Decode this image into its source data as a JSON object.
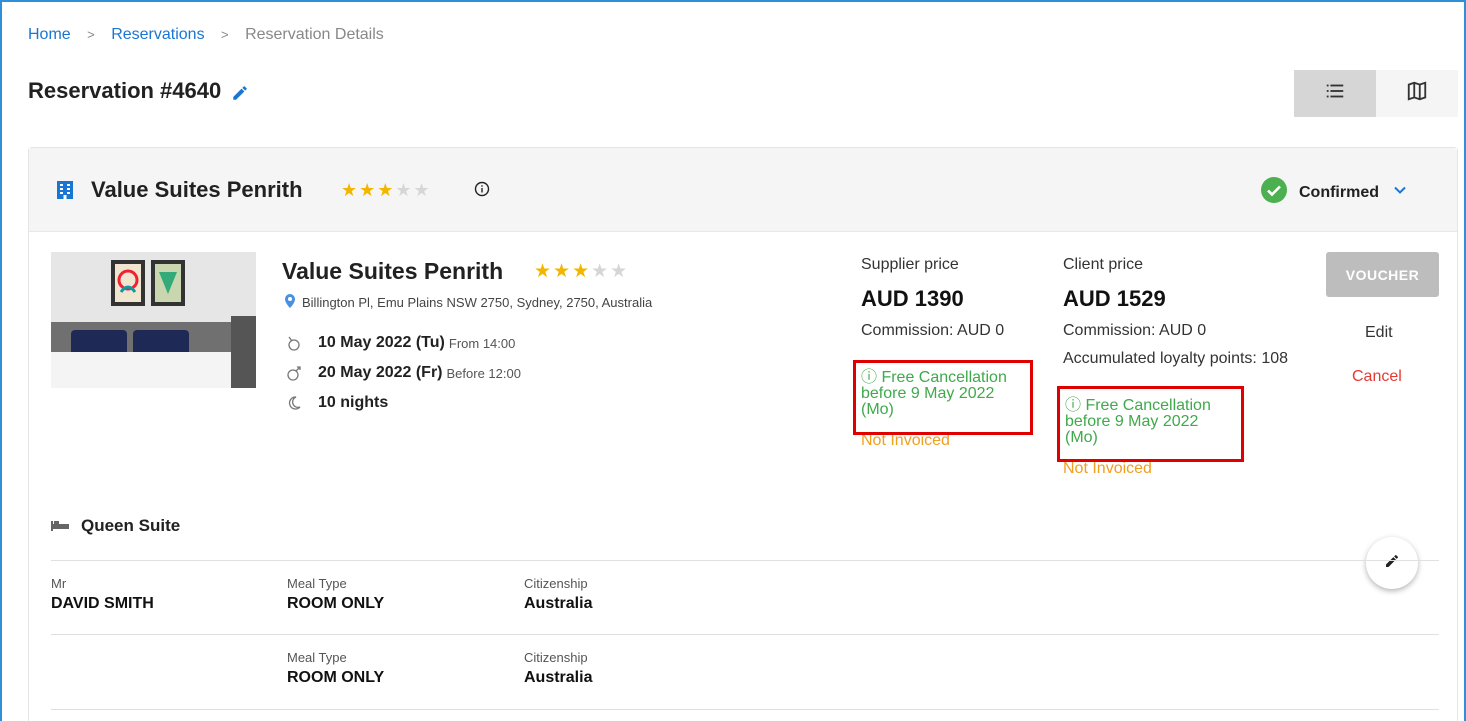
{
  "breadcrumb": {
    "home": "Home",
    "reservations": "Reservations",
    "current": "Reservation Details",
    "sep": ">"
  },
  "page": {
    "title": "Reservation #4640"
  },
  "header": {
    "hotel_name": "Value Suites Penrith",
    "stars_on": "★★★",
    "stars_off": "★★",
    "status": "Confirmed"
  },
  "hotel": {
    "name": "Value Suites Penrith",
    "stars_on": "★★★",
    "stars_off": "★★",
    "address": "Billington Pl, Emu Plains NSW 2750, Sydney, 2750, Australia",
    "checkin_date": "10 May 2022 (Tu)",
    "checkin_note": "From 14:00",
    "checkout_date": "20 May 2022 (Fr)",
    "checkout_note": "Before 12:00",
    "nights": "10 nights"
  },
  "supplier": {
    "label": "Supplier price",
    "price": "AUD 1390",
    "commission": "Commission: AUD 0",
    "free_cancel_line1": "ⓘ Free Cancellation",
    "free_cancel_line2": "before 9 May 2022",
    "free_cancel_line3": "(Mo)",
    "invoice": "Not Invoiced"
  },
  "client": {
    "label": "Client price",
    "price": "AUD 1529",
    "commission": "Commission: AUD 0",
    "loyalty": "Accumulated loyalty points: 108",
    "free_cancel_line1": "ⓘ Free Cancellation",
    "free_cancel_line2": "before 9 May 2022",
    "free_cancel_line3": "(Mo)",
    "invoice": "Not Invoiced"
  },
  "actions": {
    "voucher": "VOUCHER",
    "edit": "Edit",
    "cancel": "Cancel"
  },
  "room": {
    "name": "Queen Suite"
  },
  "guests": [
    {
      "title": "Mr",
      "name": "DAVID SMITH",
      "meal_label": "Meal Type",
      "meal": "ROOM ONLY",
      "cit_label": "Citizenship",
      "citizenship": "Australia"
    },
    {
      "title": "",
      "name": "",
      "meal_label": "Meal Type",
      "meal": "ROOM ONLY",
      "cit_label": "Citizenship",
      "citizenship": "Australia"
    }
  ],
  "colors": {
    "accent": "#1976d2",
    "green": "#3fa94b",
    "orange": "#f0a020",
    "red": "#e53935",
    "star": "#f2b600"
  }
}
